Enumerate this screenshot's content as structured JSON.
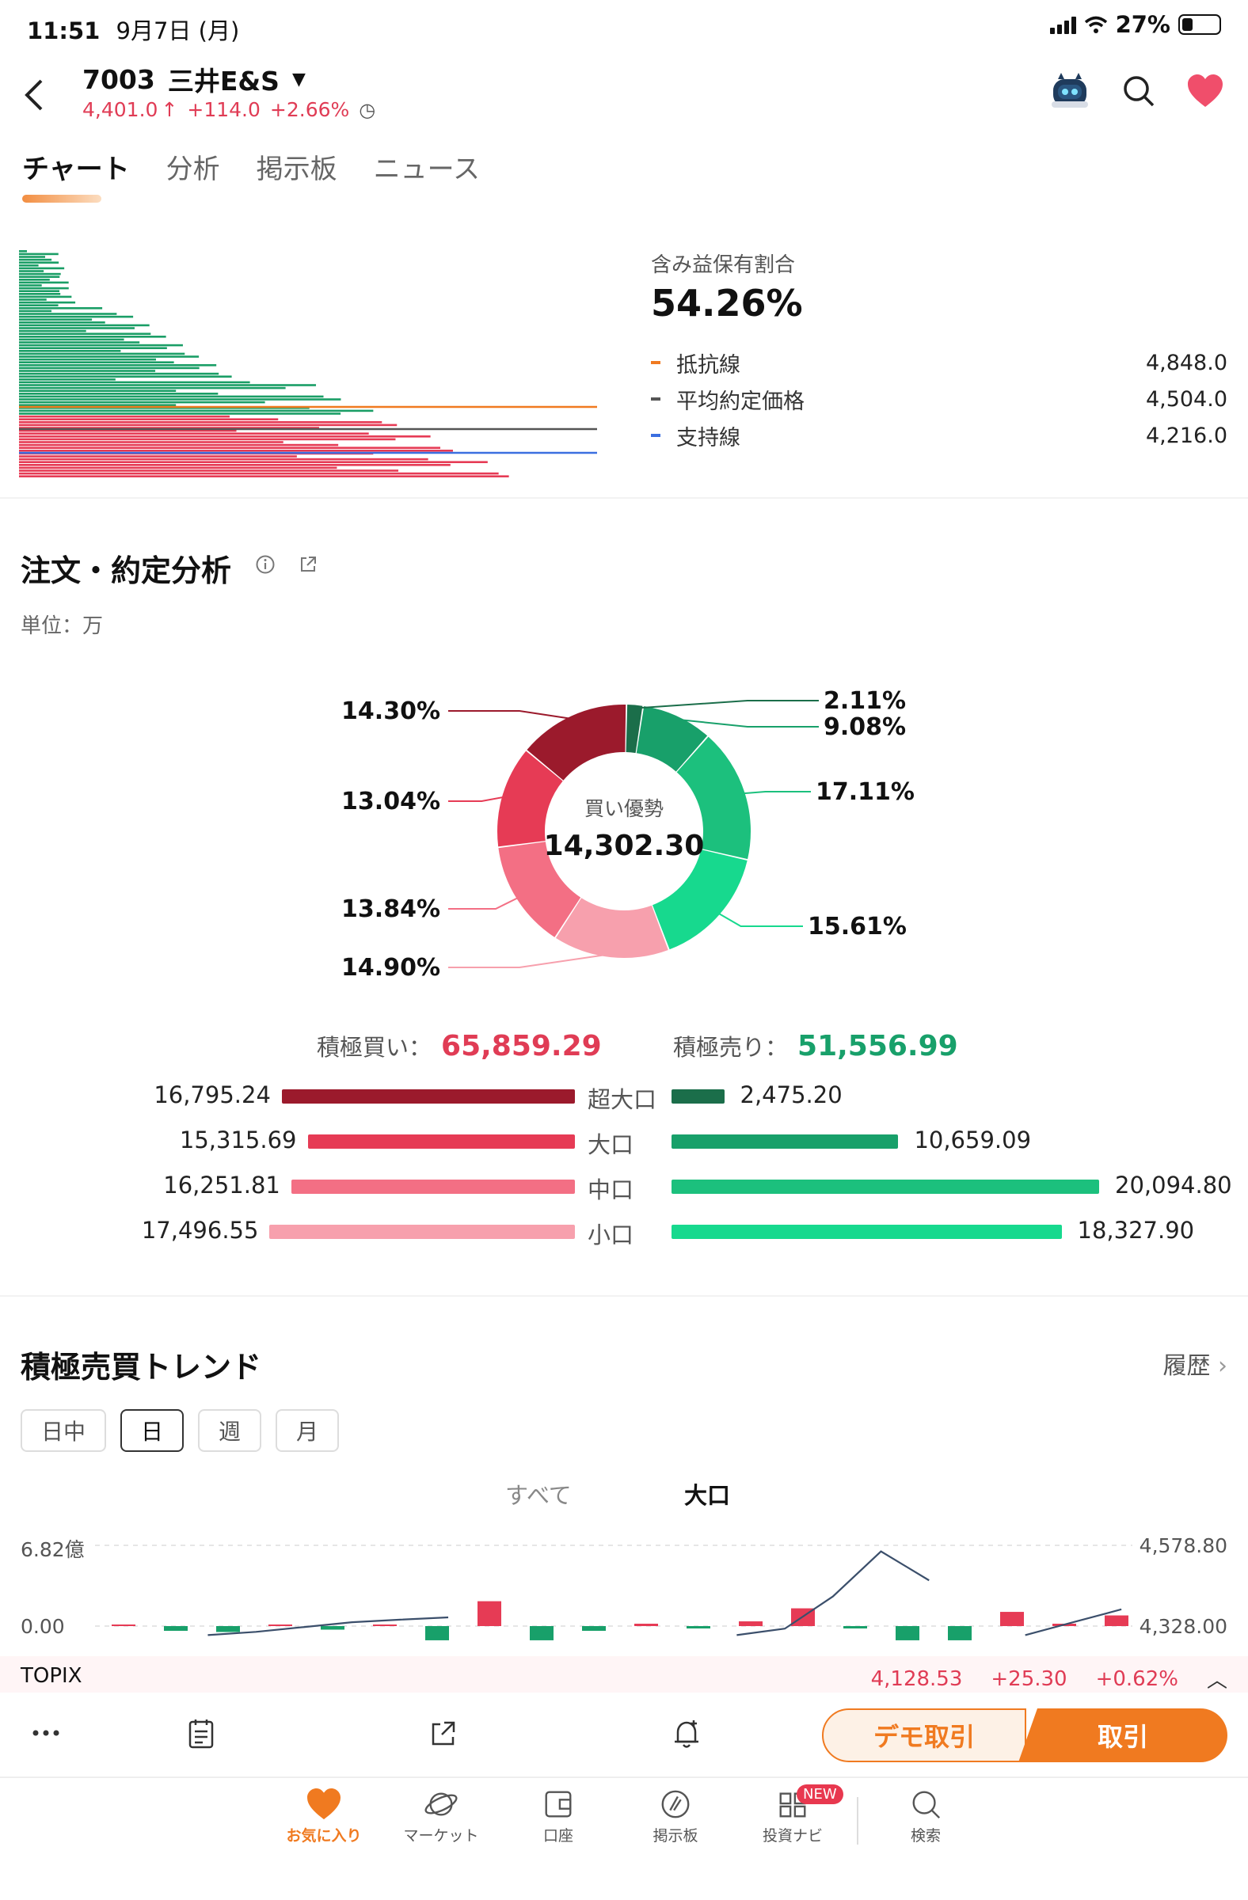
{
  "status": {
    "time": "11:51",
    "date": "9月7日 (月)",
    "battery": "27%"
  },
  "header": {
    "code": "7003",
    "name": "三井E&S",
    "price": "4,401.0",
    "change": "+114.0",
    "change_pct": "+2.66%",
    "back_icon": "chevron-left-icon",
    "robot_icon": "robot-icon",
    "search_icon": "search-icon",
    "favorite_icon": "heart-icon"
  },
  "tabs": [
    "チャート",
    "分析",
    "掲示板",
    "ニュース"
  ],
  "cost_distribution": {
    "hold_label": "含み益保有割合",
    "hold_value": "54.26%",
    "legend": [
      {
        "label": "抵抗線",
        "value": "4,848.0",
        "color": "#f07a20"
      },
      {
        "label": "平均約定価格",
        "value": "4,504.0",
        "color": "#555555"
      },
      {
        "label": "支持線",
        "value": "4,216.0",
        "color": "#3b6fe0"
      }
    ]
  },
  "order_analysis": {
    "title": "注文・約定分析",
    "unit": "単位：万",
    "donut_center_label": "買い優勢",
    "donut_center_value": "14,302.30",
    "buy_label": "積極買い：",
    "buy_total": "65,859.29",
    "sell_label": "積極売り：",
    "sell_total": "51,556.99",
    "rows": [
      {
        "category": "超大口",
        "buy": "16,795.24",
        "sell": "2,475.20"
      },
      {
        "category": "大口",
        "buy": "15,315.69",
        "sell": "10,659.09"
      },
      {
        "category": "中口",
        "buy": "16,251.81",
        "sell": "20,094.80"
      },
      {
        "category": "小口",
        "buy": "17,496.55",
        "sell": "18,327.90"
      }
    ]
  },
  "chart_data": [
    {
      "type": "pie",
      "title": "",
      "center_label": "買い優勢",
      "center_value": "14,302.30",
      "slices": [
        {
          "label": "2.11%",
          "value": 2.11,
          "side": "sell",
          "size": "超大口",
          "color": "#1b6e4a"
        },
        {
          "label": "9.08%",
          "value": 9.08,
          "side": "sell",
          "size": "大口",
          "color": "#18a06a"
        },
        {
          "label": "17.11%",
          "value": 17.11,
          "side": "sell",
          "size": "中口",
          "color": "#1cc07d"
        },
        {
          "label": "15.61%",
          "value": 15.61,
          "side": "sell",
          "size": "小口",
          "color": "#17d98e"
        },
        {
          "label": "14.90%",
          "value": 14.9,
          "side": "buy",
          "size": "小口",
          "color": "#f7a0ad"
        },
        {
          "label": "13.84%",
          "value": 13.84,
          "side": "buy",
          "size": "中口",
          "color": "#f36f84"
        },
        {
          "label": "13.04%",
          "value": 13.04,
          "side": "buy",
          "size": "大口",
          "color": "#e63b55"
        },
        {
          "label": "14.30%",
          "value": 14.3,
          "side": "buy",
          "size": "超大口",
          "color": "#9b1a2c"
        }
      ]
    },
    {
      "type": "bar",
      "title": "積極売買トレンド",
      "y_left_ticks": [
        "6.82億",
        "0.00"
      ],
      "y_right_ticks": [
        "4,578.80",
        "4,328.00"
      ],
      "y_left_top": 6.82,
      "bars": [
        0.0,
        -0.4,
        -0.5,
        0.0,
        -0.3,
        0.0,
        -1.2,
        2.1,
        -1.2,
        -0.4,
        0.2,
        -0.2,
        0.4,
        1.5,
        -0.2,
        -1.2,
        -1.2,
        1.2,
        0.1,
        0.9
      ],
      "price_line": [
        null,
        null,
        4300,
        4310,
        4325,
        4340,
        4348,
        4355,
        null,
        null,
        null,
        null,
        null,
        4300,
        4320,
        4420,
        4560,
        4470,
        null,
        4300,
        4340,
        4380
      ],
      "legend": "",
      "grid": true
    }
  ],
  "trend": {
    "title": "積極売買トレンド",
    "history": "履歴",
    "periods": [
      "日中",
      "日",
      "週",
      "月"
    ],
    "active_period": "日",
    "subtabs": [
      "すべて",
      "大口"
    ]
  },
  "topix": {
    "name": "TOPIX",
    "value": "4,128.53",
    "change": "+25.30",
    "pct": "+0.62%"
  },
  "toolbar": {
    "demo": "デモ取引",
    "trade": "取引"
  },
  "bottom_nav": [
    {
      "label": "お気に入り",
      "icon": "heart-icon"
    },
    {
      "label": "マーケット",
      "icon": "planet-icon"
    },
    {
      "label": "口座",
      "icon": "wallet-icon"
    },
    {
      "label": "掲示板",
      "icon": "board-icon"
    },
    {
      "label": "投資ナビ",
      "icon": "grid-icon",
      "badge": "NEW"
    },
    {
      "label": "検索",
      "icon": "search-icon"
    }
  ],
  "colors": {
    "accent": "#f07a20",
    "up": "#e03c55",
    "down": "#18a06a"
  }
}
